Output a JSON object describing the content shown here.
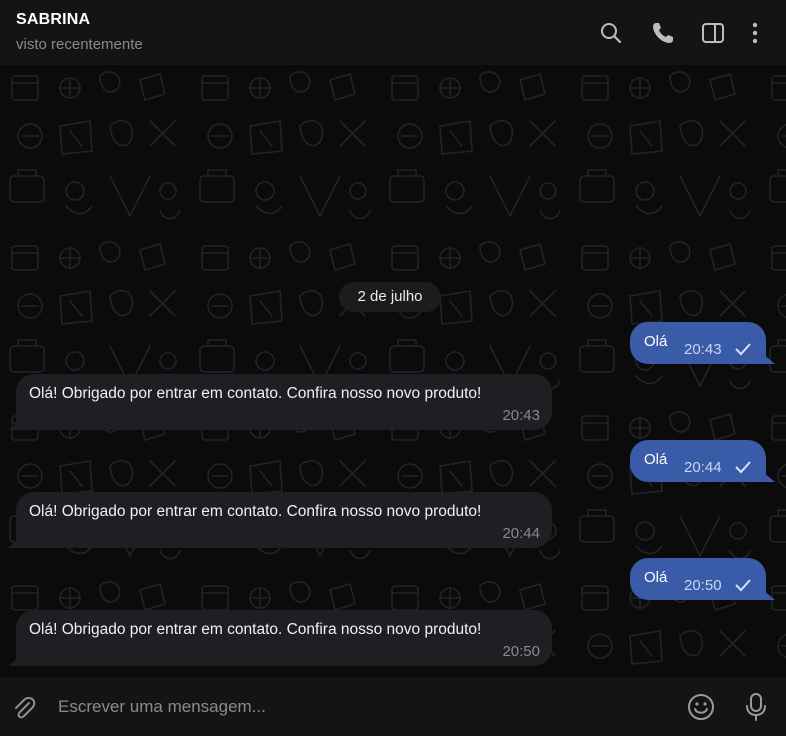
{
  "header": {
    "contact_name": "SABRINA",
    "status": "visto recentemente",
    "icons": [
      "search-icon",
      "phone-icon",
      "sidebar-toggle-icon",
      "more-vertical-icon"
    ]
  },
  "chat": {
    "date_separator": "2 de julho",
    "messages": [
      {
        "direction": "out",
        "text": "Olá",
        "time": "20:43",
        "status": "sent"
      },
      {
        "direction": "in",
        "text": "Olá! Obrigado por entrar em contato. Confira nosso novo produto!",
        "time": "20:43"
      },
      {
        "direction": "out",
        "text": "Olá",
        "time": "20:44",
        "status": "sent"
      },
      {
        "direction": "in",
        "text": "Olá! Obrigado por entrar em contato. Confira nosso novo produto!",
        "time": "20:44"
      },
      {
        "direction": "out",
        "text": "Olá",
        "time": "20:50",
        "status": "sent"
      },
      {
        "direction": "in",
        "text": "Olá! Obrigado por entrar em contato. Confira nosso novo produto!",
        "time": "20:50"
      }
    ]
  },
  "composer": {
    "placeholder": "Escrever uma mensagem...",
    "icons": [
      "paperclip-icon",
      "emoji-icon",
      "microphone-icon"
    ]
  },
  "colors": {
    "outgoing_bubble": "#3a5ca8",
    "incoming_bubble": "#1f1e22",
    "background": "#0b0b0c",
    "header": "#141414"
  }
}
